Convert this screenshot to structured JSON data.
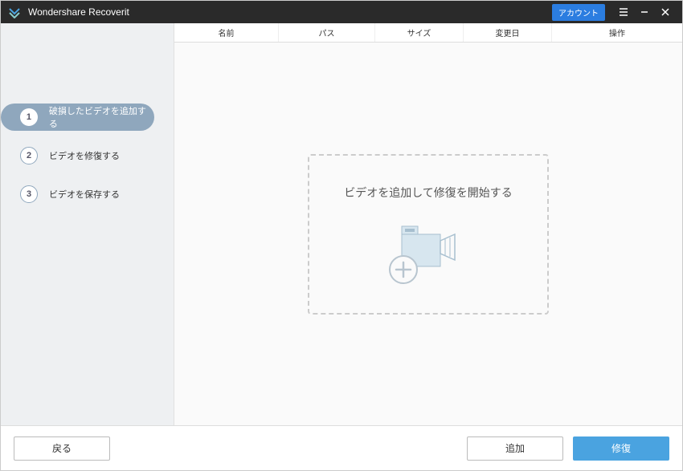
{
  "titlebar": {
    "app_name": "Wondershare Recoverit",
    "account_label": "アカウント"
  },
  "sidebar": {
    "steps": [
      {
        "num": "1",
        "label": "破損したビデオを追加する",
        "active": true
      },
      {
        "num": "2",
        "label": "ビデオを修復する",
        "active": false
      },
      {
        "num": "3",
        "label": "ビデオを保存する",
        "active": false
      }
    ]
  },
  "table": {
    "columns": {
      "name": "名前",
      "path": "パス",
      "size": "サイズ",
      "date": "変更日",
      "action": "操作"
    }
  },
  "dropzone": {
    "text": "ビデオを追加して修復を開始する"
  },
  "footer": {
    "back": "戻る",
    "add": "追加",
    "repair": "修復"
  }
}
